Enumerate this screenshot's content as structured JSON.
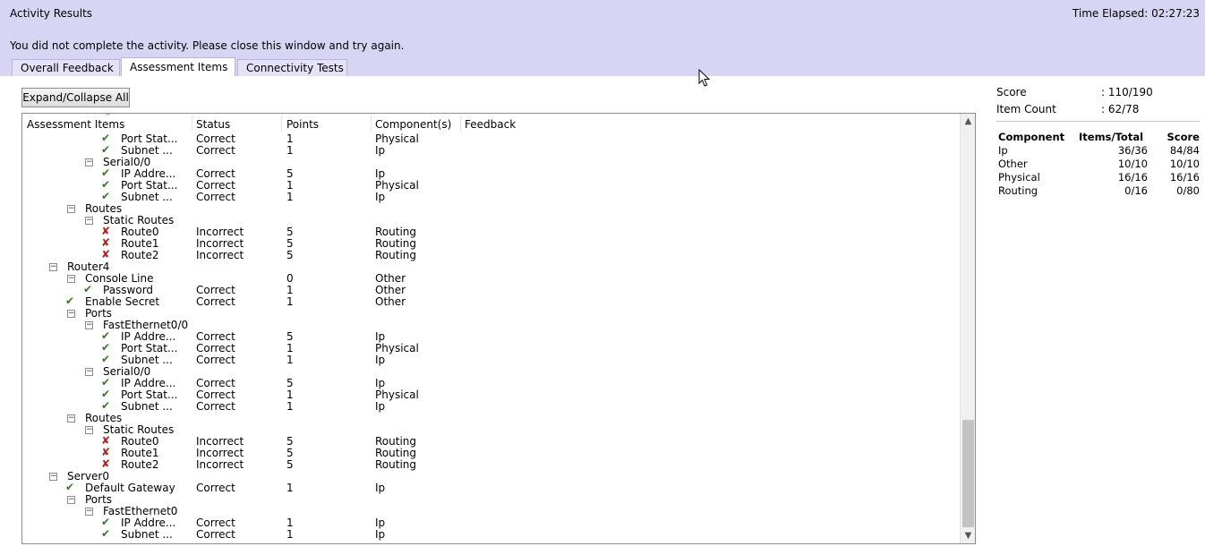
{
  "window": {
    "title": "Activity Results",
    "time_elapsed": "Time Elapsed: 02:27:23"
  },
  "message": "You did not complete the activity. Please close this window and try again.",
  "tabs": [
    {
      "label": "Overall Feedback",
      "active": false
    },
    {
      "label": "Assessment Items",
      "active": true
    },
    {
      "label": "Connectivity Tests",
      "active": false
    }
  ],
  "expand_button": "Expand/Collapse All",
  "columns": [
    "Assessment Items",
    "Status",
    "Points",
    "Component(s)",
    "Feedback"
  ],
  "rows": [
    {
      "level": 4,
      "name": "Port Stat...",
      "icon": "check",
      "status": "Correct",
      "points": "1",
      "component": "Physical"
    },
    {
      "level": 4,
      "name": "Subnet ...",
      "icon": "check",
      "status": "Correct",
      "points": "1",
      "component": "Ip"
    },
    {
      "level": 3,
      "name": "Serial0/0",
      "icon": "minus",
      "status": "",
      "points": "",
      "component": ""
    },
    {
      "level": 4,
      "name": "IP Addre...",
      "icon": "check",
      "status": "Correct",
      "points": "5",
      "component": "Ip"
    },
    {
      "level": 4,
      "name": "Port Stat...",
      "icon": "check",
      "status": "Correct",
      "points": "1",
      "component": "Physical"
    },
    {
      "level": 4,
      "name": "Subnet ...",
      "icon": "check",
      "status": "Correct",
      "points": "1",
      "component": "Ip"
    },
    {
      "level": 2,
      "name": "Routes",
      "icon": "minus",
      "status": "",
      "points": "",
      "component": ""
    },
    {
      "level": 3,
      "name": "Static Routes",
      "icon": "minus",
      "status": "",
      "points": "",
      "component": ""
    },
    {
      "level": 4,
      "name": "Route0",
      "icon": "cross",
      "status": "Incorrect",
      "points": "5",
      "component": "Routing"
    },
    {
      "level": 4,
      "name": "Route1",
      "icon": "cross",
      "status": "Incorrect",
      "points": "5",
      "component": "Routing"
    },
    {
      "level": 4,
      "name": "Route2",
      "icon": "cross",
      "status": "Incorrect",
      "points": "5",
      "component": "Routing"
    },
    {
      "level": 1,
      "name": "Router4",
      "icon": "minus",
      "status": "",
      "points": "",
      "component": ""
    },
    {
      "level": 2,
      "name": "Console Line",
      "icon": "minus",
      "status": "",
      "points": "0",
      "component": "Other"
    },
    {
      "level": 3,
      "name": "Password",
      "icon": "check",
      "status": "Correct",
      "points": "1",
      "component": "Other"
    },
    {
      "level": 2,
      "name": "Enable Secret",
      "icon": "check",
      "status": "Correct",
      "points": "1",
      "component": "Other"
    },
    {
      "level": 2,
      "name": "Ports",
      "icon": "minus",
      "status": "",
      "points": "",
      "component": ""
    },
    {
      "level": 3,
      "name": "FastEthernet0/0",
      "icon": "minus",
      "status": "",
      "points": "",
      "component": ""
    },
    {
      "level": 4,
      "name": "IP Addre...",
      "icon": "check",
      "status": "Correct",
      "points": "5",
      "component": "Ip"
    },
    {
      "level": 4,
      "name": "Port Stat...",
      "icon": "check",
      "status": "Correct",
      "points": "1",
      "component": "Physical"
    },
    {
      "level": 4,
      "name": "Subnet ...",
      "icon": "check",
      "status": "Correct",
      "points": "1",
      "component": "Ip"
    },
    {
      "level": 3,
      "name": "Serial0/0",
      "icon": "minus",
      "status": "",
      "points": "",
      "component": ""
    },
    {
      "level": 4,
      "name": "IP Addre...",
      "icon": "check",
      "status": "Correct",
      "points": "5",
      "component": "Ip"
    },
    {
      "level": 4,
      "name": "Port Stat...",
      "icon": "check",
      "status": "Correct",
      "points": "1",
      "component": "Physical"
    },
    {
      "level": 4,
      "name": "Subnet ...",
      "icon": "check",
      "status": "Correct",
      "points": "1",
      "component": "Ip"
    },
    {
      "level": 2,
      "name": "Routes",
      "icon": "minus",
      "status": "",
      "points": "",
      "component": ""
    },
    {
      "level": 3,
      "name": "Static Routes",
      "icon": "minus",
      "status": "",
      "points": "",
      "component": ""
    },
    {
      "level": 4,
      "name": "Route0",
      "icon": "cross",
      "status": "Incorrect",
      "points": "5",
      "component": "Routing"
    },
    {
      "level": 4,
      "name": "Route1",
      "icon": "cross",
      "status": "Incorrect",
      "points": "5",
      "component": "Routing"
    },
    {
      "level": 4,
      "name": "Route2",
      "icon": "cross",
      "status": "Incorrect",
      "points": "5",
      "component": "Routing"
    },
    {
      "level": 1,
      "name": "Server0",
      "icon": "minus",
      "status": "",
      "points": "",
      "component": ""
    },
    {
      "level": 2,
      "name": "Default Gateway",
      "icon": "check",
      "status": "Correct",
      "points": "1",
      "component": "Ip"
    },
    {
      "level": 2,
      "name": "Ports",
      "icon": "minus",
      "status": "",
      "points": "",
      "component": ""
    },
    {
      "level": 3,
      "name": "FastEthernet0",
      "icon": "minus",
      "status": "",
      "points": "",
      "component": ""
    },
    {
      "level": 4,
      "name": "IP Addre...",
      "icon": "check",
      "status": "Correct",
      "points": "1",
      "component": "Ip"
    },
    {
      "level": 4,
      "name": "Subnet ...",
      "icon": "check",
      "status": "Correct",
      "points": "1",
      "component": "Ip"
    }
  ],
  "summary": {
    "score_label": "Score",
    "score_value": ": 110/190",
    "item_count_label": "Item Count",
    "item_count_value": ": 62/78",
    "component_headers": [
      "Component",
      "Items/Total",
      "Score"
    ],
    "components": [
      {
        "name": "Ip",
        "items": "36/36",
        "score": "84/84"
      },
      {
        "name": "Other",
        "items": "10/10",
        "score": "10/10"
      },
      {
        "name": "Physical",
        "items": "16/16",
        "score": "16/16"
      },
      {
        "name": "Routing",
        "items": "0/16",
        "score": "0/80"
      }
    ]
  },
  "icons": {
    "check": "checkmark-icon",
    "cross": "cross-icon",
    "minus": "collapse-toggle-icon"
  },
  "colors": {
    "header_bg": "#d8d4f4",
    "correct": "#2e7d1f",
    "incorrect": "#b22222"
  }
}
